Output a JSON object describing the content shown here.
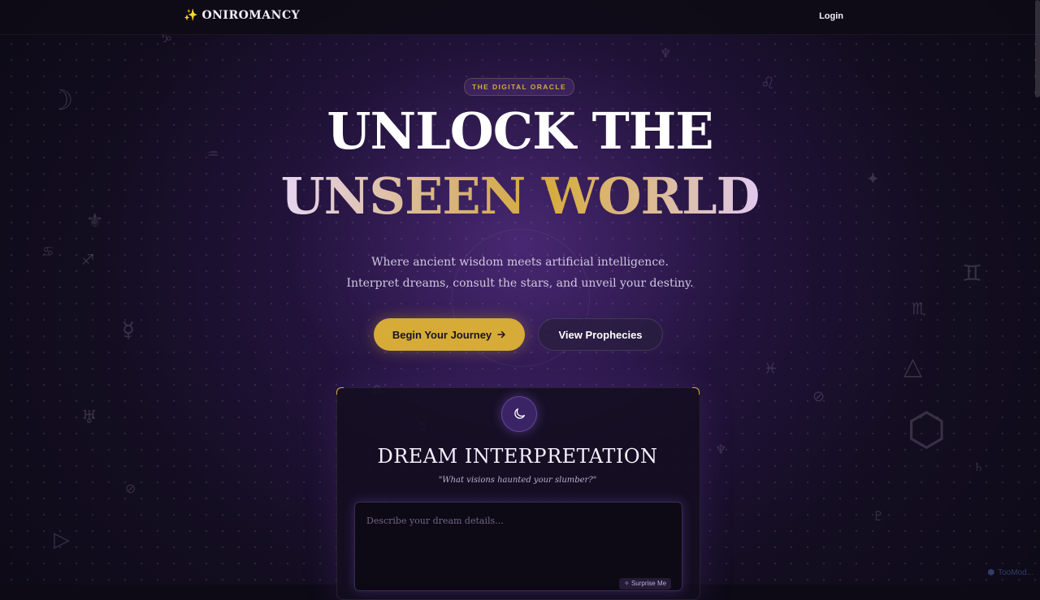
{
  "nav": {
    "brand_icon": "sparkles-icon",
    "brand_name": "ONIROMANCY",
    "login_label": "Login"
  },
  "hero": {
    "badge": "THE DIGITAL ORACLE",
    "title_line1": "UNLOCK THE",
    "title_line2": "UNSEEN WORLD",
    "subtitle_line1": "Where ancient wisdom meets artificial intelligence.",
    "subtitle_line2": "Interpret dreams, consult the stars, and unveil your destiny.",
    "primary_button": "Begin Your Journey",
    "primary_button_icon": "arrow-right-icon",
    "secondary_button": "View Prophecies"
  },
  "dream_card": {
    "icon": "moon-icon",
    "title": "DREAM INTERPRETATION",
    "tagline": "\"What visions haunted your slumber?\"",
    "input_placeholder": "Describe your dream details...",
    "input_value": "",
    "surprise_label": "Surprise Me"
  },
  "watermark": {
    "icon": "shield-logo-icon",
    "text": "TooMod..."
  },
  "colors": {
    "accent_gold": "#d6ab38",
    "background": "#0d0a16",
    "purple_glow": "#6c3aa8"
  }
}
